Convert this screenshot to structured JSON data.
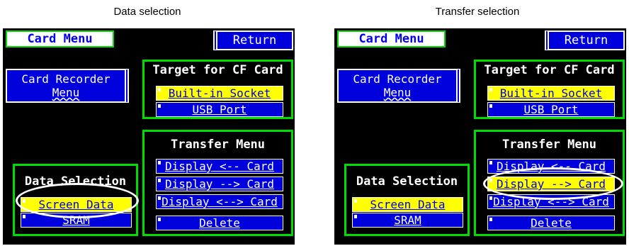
{
  "captions": {
    "left": "Data selection",
    "right": "Transfer selection"
  },
  "screens": [
    {
      "title": "Card Menu",
      "return_label": "Return",
      "recorder_line1": "Card Recorder",
      "recorder_line2": "Menu",
      "target_title": "Target for CF Card",
      "target_options": [
        {
          "label": "Built-in Socket",
          "selected": true
        },
        {
          "label": "USB Port",
          "selected": false
        }
      ],
      "transfer_title": "Transfer Menu",
      "transfer_options": [
        {
          "label": "Display <-- Card",
          "selected": false
        },
        {
          "label": "Display --> Card",
          "selected": false
        },
        {
          "label": "Display <--> Card",
          "selected": false
        },
        {
          "label": "Delete",
          "selected": false
        }
      ],
      "data_title": "Data Selection",
      "data_options": [
        {
          "label": "Screen Data",
          "selected": true
        },
        {
          "label": "SRAM",
          "selected": false
        }
      ]
    },
    {
      "title": "Card Menu",
      "return_label": "Return",
      "recorder_line1": "Card Recorder",
      "recorder_line2": "Menu",
      "target_title": "Target for CF Card",
      "target_options": [
        {
          "label": "Built-in Socket",
          "selected": true
        },
        {
          "label": "USB Port",
          "selected": false
        }
      ],
      "transfer_title": "Transfer Menu",
      "transfer_options": [
        {
          "label": "Display <-- Card",
          "selected": false
        },
        {
          "label": "Display --> Card",
          "selected": true
        },
        {
          "label": "Display <--> Card",
          "selected": false
        },
        {
          "label": "Delete",
          "selected": false
        }
      ],
      "data_title": "Data Selection",
      "data_options": [
        {
          "label": "Screen Data",
          "selected": true
        },
        {
          "label": "SRAM",
          "selected": false
        }
      ]
    }
  ],
  "colors": {
    "screen_bg": "#000000",
    "frame": "#00dd00",
    "button": "#0000dd",
    "selected": "#ffff00",
    "highlight_oval": "#ffffff"
  }
}
